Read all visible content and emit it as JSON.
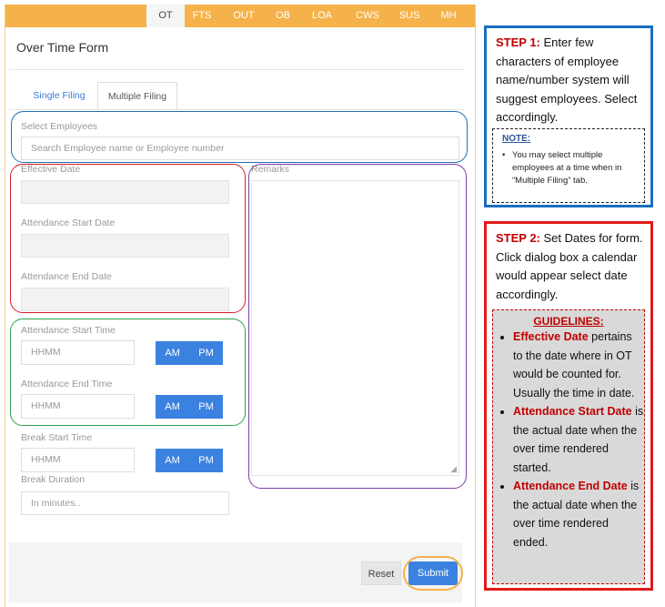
{
  "nav": {
    "tabs": [
      "OT",
      "FTS",
      "OUT",
      "OB",
      "LOA",
      "CWS",
      "SUS",
      "MH"
    ],
    "active": "OT"
  },
  "form": {
    "title": "Over Time Form",
    "subtabs": {
      "single": "Single Filing",
      "multiple": "Multiple Filing"
    },
    "select_employees_label": "Select Employees",
    "search_placeholder": "Search Employee name or Employee number",
    "effective_date_label": "Effective Date",
    "remarks_label": "Remarks",
    "att_start_date_label": "Attendance Start Date",
    "att_end_date_label": "Attendance End Date",
    "att_start_time_label": "Attendance Start Time",
    "att_end_time_label": "Attendance End Time",
    "break_start_label": "Break Start Time",
    "break_duration_label": "Break Duration",
    "time_placeholder": "HHMM",
    "duration_placeholder": "In minutes..",
    "am": "AM",
    "pm": "PM",
    "reset": "Reset",
    "submit": "Submit"
  },
  "instructions": {
    "step1_label": "STEP 1:",
    "step1_text": "Enter few characters of employee name/number system will suggest employees. Select accordingly.",
    "note_title": "NOTE",
    "note_text": "You may select multiple employees at a time when in “Multiple Filing” tab.",
    "step2_label": "STEP 2:",
    "step2_text": "Set Dates for form. Click dialog box a calendar would appear select date accordingly.",
    "guidelines_title": "GUIDELINES:",
    "guidelines": [
      {
        "term": "Effective Date",
        "text": "pertains to the date where in OT would be counted for. Usually the time in date."
      },
      {
        "term": "Attendance Start Date",
        "text": "is the actual date when the over time rendered started."
      },
      {
        "term": "Attendance End Date",
        "text": "is the actual date when the over time rendered ended."
      }
    ]
  },
  "colors": {
    "topbar": "#f6b24a",
    "accent_blue": "#3b82e0",
    "box_blue": "#1f6fb5",
    "box_red": "#d61f26",
    "box_green": "#2ba24c",
    "box_purple": "#7b3fa8",
    "step1_border": "#1b6fc0",
    "step2_border": "#e11919"
  }
}
